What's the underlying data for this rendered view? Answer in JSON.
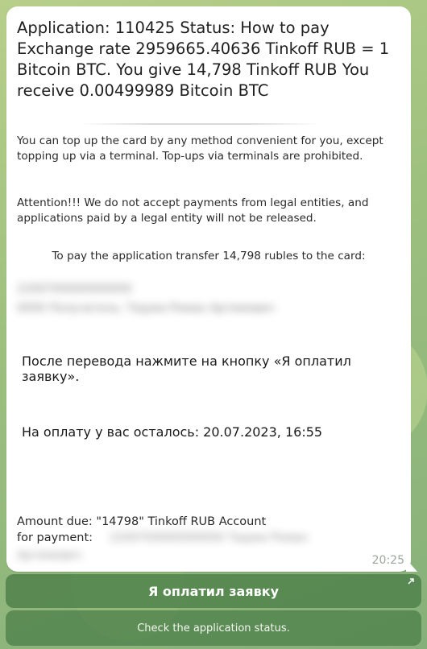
{
  "message": {
    "headline": "Application: 110425 Status: How to pay Exchange rate 2959665.40636 Tinkoff RUB = 1 Bitcoin BTC. You give 14,798 Tinkoff RUB You receive 0.00499989 Bitcoin BTC",
    "topup_note": "You can top up the card by any method convenient for you, except topping up via a terminal. Top-ups via terminals are prohibited.",
    "attention_note": "Attention!!! We do not accept payments from legal entities, and applications paid by a legal entity will not be released.",
    "transfer_note": "To pay the application transfer 14,798 rubles to the card:",
    "hidden_card_number": "2200700000000000",
    "hidden_card_holder": "0000 Получатель: Тиджи Роман Артемович",
    "after_transfer_note": "После перевода нажмите на кнопку «Я оплатил заявку».",
    "time_left_note": "На оплату у вас осталось: 20.07.2023, 16:55",
    "amount_due": "Amount due: \"14798\" Tinkoff RUB Account for payment:",
    "hidden_account": "2200700000000000 Тиджи Роман",
    "hidden_account_tail": "Артемович",
    "timestamp": "20:25"
  },
  "buttons": {
    "paid_label": "Я оплатил заявку",
    "status_label": "Check the application status."
  },
  "icons": {
    "paid_button_icon": "arrow-up-right-icon"
  },
  "colors": {
    "bubble": "#ffffff",
    "button_bg": "#4a7d46",
    "background": "#9cbf7e"
  }
}
